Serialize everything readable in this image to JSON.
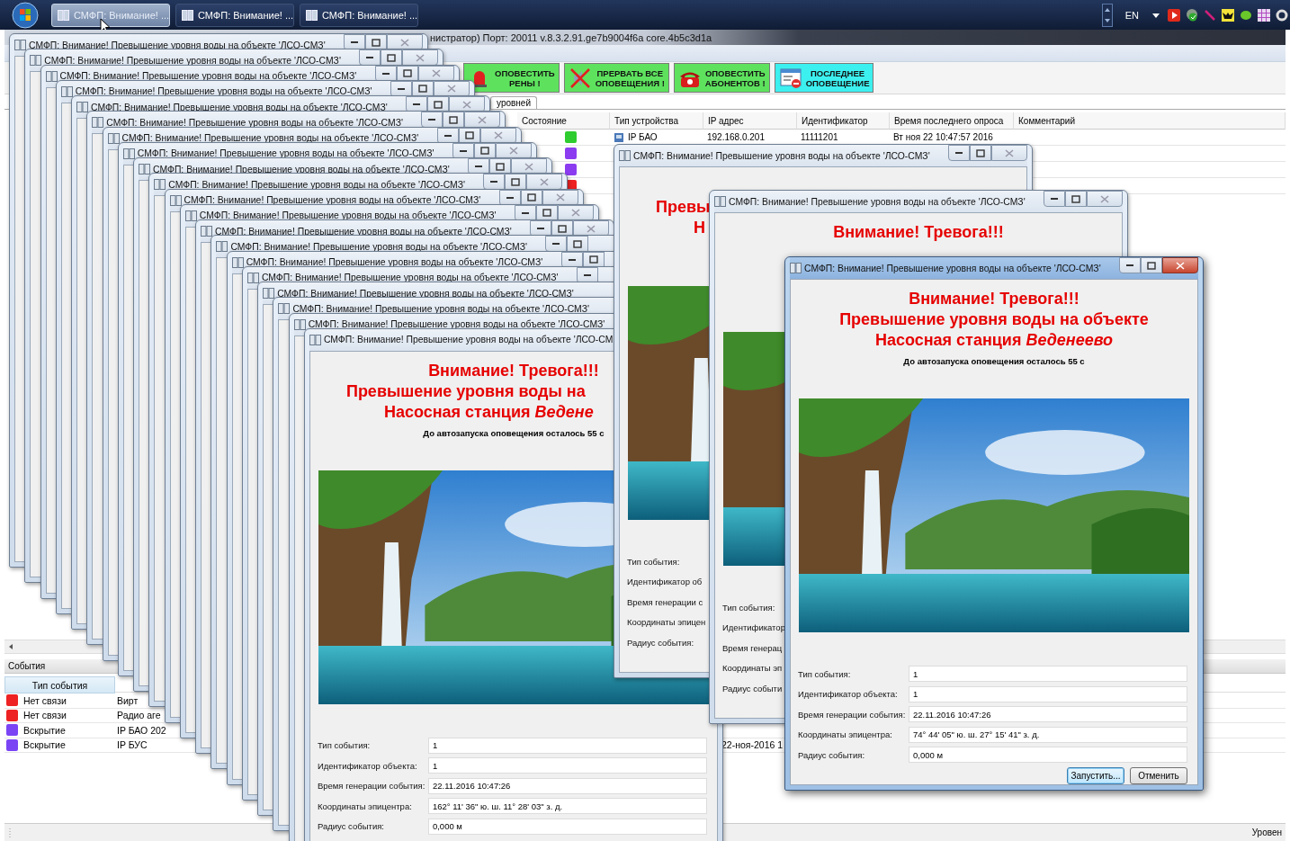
{
  "taskbar": {
    "buttons": [
      {
        "label": "СМФП: Внимание! ...",
        "selected": true
      },
      {
        "label": "СМФП: Внимание! ...",
        "selected": false
      },
      {
        "label": "СМФП: Внимание! ...",
        "selected": false
      }
    ],
    "language": "EN"
  },
  "main_window": {
    "title": "нистратор) Порт: 20011 v.8.3.2.91.ge7b9004f6a core.4b5c3d1a",
    "toolbar": [
      {
        "kind": "siren",
        "lines": [
          "ОПОВЕСТИТЬ",
          "РЕНЫ !"
        ],
        "color": "#5ee25e"
      },
      {
        "kind": "cancel",
        "lines": [
          "ПРЕРВАТЬ ВСЕ",
          "ОПОВЕЩЕНИЯ !"
        ],
        "color": "#5ee25e"
      },
      {
        "kind": "phone",
        "lines": [
          "ОПОВЕСТИТЬ",
          "АБОНЕНТОВ !"
        ],
        "color": "#5ee25e"
      },
      {
        "kind": "list",
        "lines": [
          "ПОСЛЕДНЕЕ",
          "ОПОВЕЩЕНИЕ"
        ],
        "color": "#3cf0ef"
      }
    ],
    "tab": "уровней",
    "devices": {
      "columns": [
        "Состояние",
        "Тип устройства",
        "IP адрес",
        "Идентификатор",
        "Время последнего опроса",
        "Комментарий"
      ],
      "rows": [
        {
          "color": "#2ecc2e",
          "device": "IP БАО",
          "ip": "192.168.0.201",
          "id": "11111201",
          "time": "Вт ноя 22 10:47:57 2016"
        },
        {
          "color": "#8c3cf0"
        },
        {
          "color": "#8c3cf0"
        },
        {
          "color": "#ee2222"
        }
      ]
    },
    "events": {
      "title": "События",
      "column": "Тип события",
      "rows": [
        {
          "color": "#ee2222",
          "type": "Нет связи",
          "source": "Вирт"
        },
        {
          "color": "#ee2222",
          "type": "Нет связи",
          "source": "Радио аге"
        },
        {
          "color": "#7a44f5",
          "type": "Вскрытие",
          "source": "IP БАО 202"
        },
        {
          "color": "#7a44f5",
          "type": "Вскрытие",
          "source": "IP БУС",
          "time": "22-ноя-2016 1"
        }
      ]
    },
    "status": "Уровен"
  },
  "windows": [
    {
      "title": "СМФП: Внимание! Превышение уровня воды на объекте 'ЛСО-СМЗ'",
      "active": false
    },
    {
      "title": "СМФП: Внимание! Превышение уровня воды на объекте 'ЛСО-СМЗ'",
      "active": false
    },
    {
      "title": "СМФП: Внимание! Превышение уровня воды на объекте 'ЛСО-СМЗ'",
      "active": false
    },
    {
      "title": "СМФП: Внимание! Превышение уровня воды на объекте 'ЛСО-СМЗ'",
      "active": false
    },
    {
      "title": "СМФП: Внимание! Превышение уровня воды на объекте 'ЛСО-СМЗ'",
      "active": false
    },
    {
      "title": "СМФП: Внимание! Превышение уровня воды на объекте 'ЛСО-СМЗ'",
      "active": false
    },
    {
      "title": "СМФП: Внимание! Превышение уровня воды на объекте 'ЛСО-СМЗ'",
      "active": false
    },
    {
      "title": "СМФП: Внимание! Превышение уровня воды на объекте 'ЛСО-СМЗ'",
      "active": false
    },
    {
      "title": "СМФП: Внимание! Превышение уровня воды на объекте 'ЛСО-СМЗ'",
      "active": false
    },
    {
      "title": "СМФП: Внимание! Превышение уровня воды на объекте 'ЛСО-СМЗ'",
      "active": false
    },
    {
      "title": "СМФП: Внимание! Превышение уровня воды на объекте 'ЛСО-СМЗ'",
      "active": false
    },
    {
      "title": "СМФП: Внимание! Превышение уровня воды на объекте 'ЛСО-СМЗ'",
      "active": false
    },
    {
      "title": "СМФП: Внимание! Превышение уровня воды на объекте 'ЛСО-СМЗ'",
      "active": false
    },
    {
      "title": "СМФП: Внимание! Превышение уровня воды на объекте 'ЛСО-СМЗ'",
      "active": false
    },
    {
      "title": "СМФП: Внимание! Превышение уровня воды на объекте 'ЛСО-СМЗ'",
      "active": false
    },
    {
      "title": "СМФП: Внимание! Превышение уровня воды на объекте 'ЛСО-СМЗ'",
      "active": false
    },
    {
      "title": "СМФП: Внимание! Превышение уровня воды на объекте 'ЛСО-СМЗ'",
      "active": false
    },
    {
      "title": "СМФП: Внимание! Превышение уровня воды на объекте 'ЛСО-СМЗ'",
      "active": false
    },
    {
      "title": "СМФП: Внимание! Превышение уровня воды на объекте 'ЛСО-СМЗ'",
      "active": false
    },
    {
      "title": "СМФП: Внимание! Превышение уровня воды на объекте 'ЛСО-СМ",
      "active": false,
      "body": {
        "headings": {
          "line_1": {
            "text": "Внимание! Тревога!!!",
            "cut": false
          },
          "line_2": {
            "text": "Превышение уровня воды на",
            "cut": true
          },
          "line_3": {
            "text": "Насосная станция *Ведене*",
            "cut": true
          }
        },
        "countdown": "До автозапуска оповещения осталось 55 с",
        "fields": [
          {
            "label": "Тип события:",
            "value": "1"
          },
          {
            "label": "Идентификатор объекта:",
            "value": "1"
          },
          {
            "label": "Время генерации события:",
            "value": "22.11.2016 10:47:26"
          },
          {
            "label": "Координаты эпицентра:",
            "value": "162° 11' 36\" ю. ш. 11° 28' 03\" з. д."
          },
          {
            "label": "Радиус события:",
            "value": "0,000 м"
          }
        ]
      }
    },
    {
      "title": "СМФП: Внимание! Превышение уровня воды на объекте 'ЛСО-СМЗ'",
      "active": false,
      "body": {
        "headings": {
          "line_2": {
            "text": "Превы",
            "cut": true
          },
          "line_3": {
            "text": "Н",
            "cut": true
          }
        },
        "fields": [
          {
            "label": "Тип события:"
          },
          {
            "label": "Идентификатор об"
          },
          {
            "label": "Время генерации с"
          },
          {
            "label": "Координаты эпицен"
          },
          {
            "label": "Радиус события:"
          }
        ]
      }
    },
    {
      "title": "СМФП: Внимание! Превышение уровня воды на объекте 'ЛСО-СМЗ'",
      "active": false,
      "body": {
        "headings": {
          "line_1": {
            "text": "Внимание! Тревога!!!",
            "cut": false
          }
        },
        "fields": [
          {
            "label": "Тип события:"
          },
          {
            "label": "Идентификатор"
          },
          {
            "label": "Время генерац"
          },
          {
            "label": "Координаты эп"
          },
          {
            "label": "Радиус событи"
          }
        ]
      }
    },
    {
      "title": "СМФП: Внимание! Превышение уровня воды на объекте 'ЛСО-СМЗ'",
      "active": true,
      "body": {
        "headings": {
          "line_1": {
            "text": "Внимание! Тревога!!!",
            "cut": false
          },
          "line_2": {
            "text": "Превышение уровня воды на объекте",
            "cut": false
          },
          "line_3": {
            "text": "Насосная станция *Веденеево*",
            "cut": false
          }
        },
        "countdown": "До автозапуска оповещения осталось 55 с",
        "fields": [
          {
            "label": "Тип события:",
            "value": "1"
          },
          {
            "label": "Идентификатор объекта:",
            "value": "1"
          },
          {
            "label": "Время генерации события:",
            "value": "22.11.2016 10:47:26"
          },
          {
            "label": "Координаты эпицентра:",
            "value": "74° 44' 05\" ю. ш. 27° 15' 41\" з. д."
          },
          {
            "label": "Радиус события:",
            "value": "0,000 м"
          }
        ],
        "buttons": [
          {
            "label": "Запустить...",
            "focused": true
          },
          {
            "label": "Отменить",
            "focused": false
          }
        ]
      }
    }
  ]
}
